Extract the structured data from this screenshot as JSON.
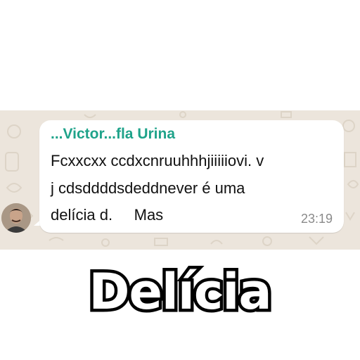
{
  "chat": {
    "sender_name": "...Victor...fla Urina",
    "message_lines": [
      "Fcxxcxx ccdxcnruuhhhjiiiiiovi. v",
      "j cdsddddsdeddnever é uma",
      "delícia d.     Mas"
    ],
    "time": "23:19",
    "colors": {
      "background": "#ece5dc",
      "bubble": "#ffffff",
      "sender": "#1fa38a",
      "text": "#111111",
      "time": "#8a8a8a"
    }
  },
  "meme": {
    "caption": "Delícia"
  }
}
